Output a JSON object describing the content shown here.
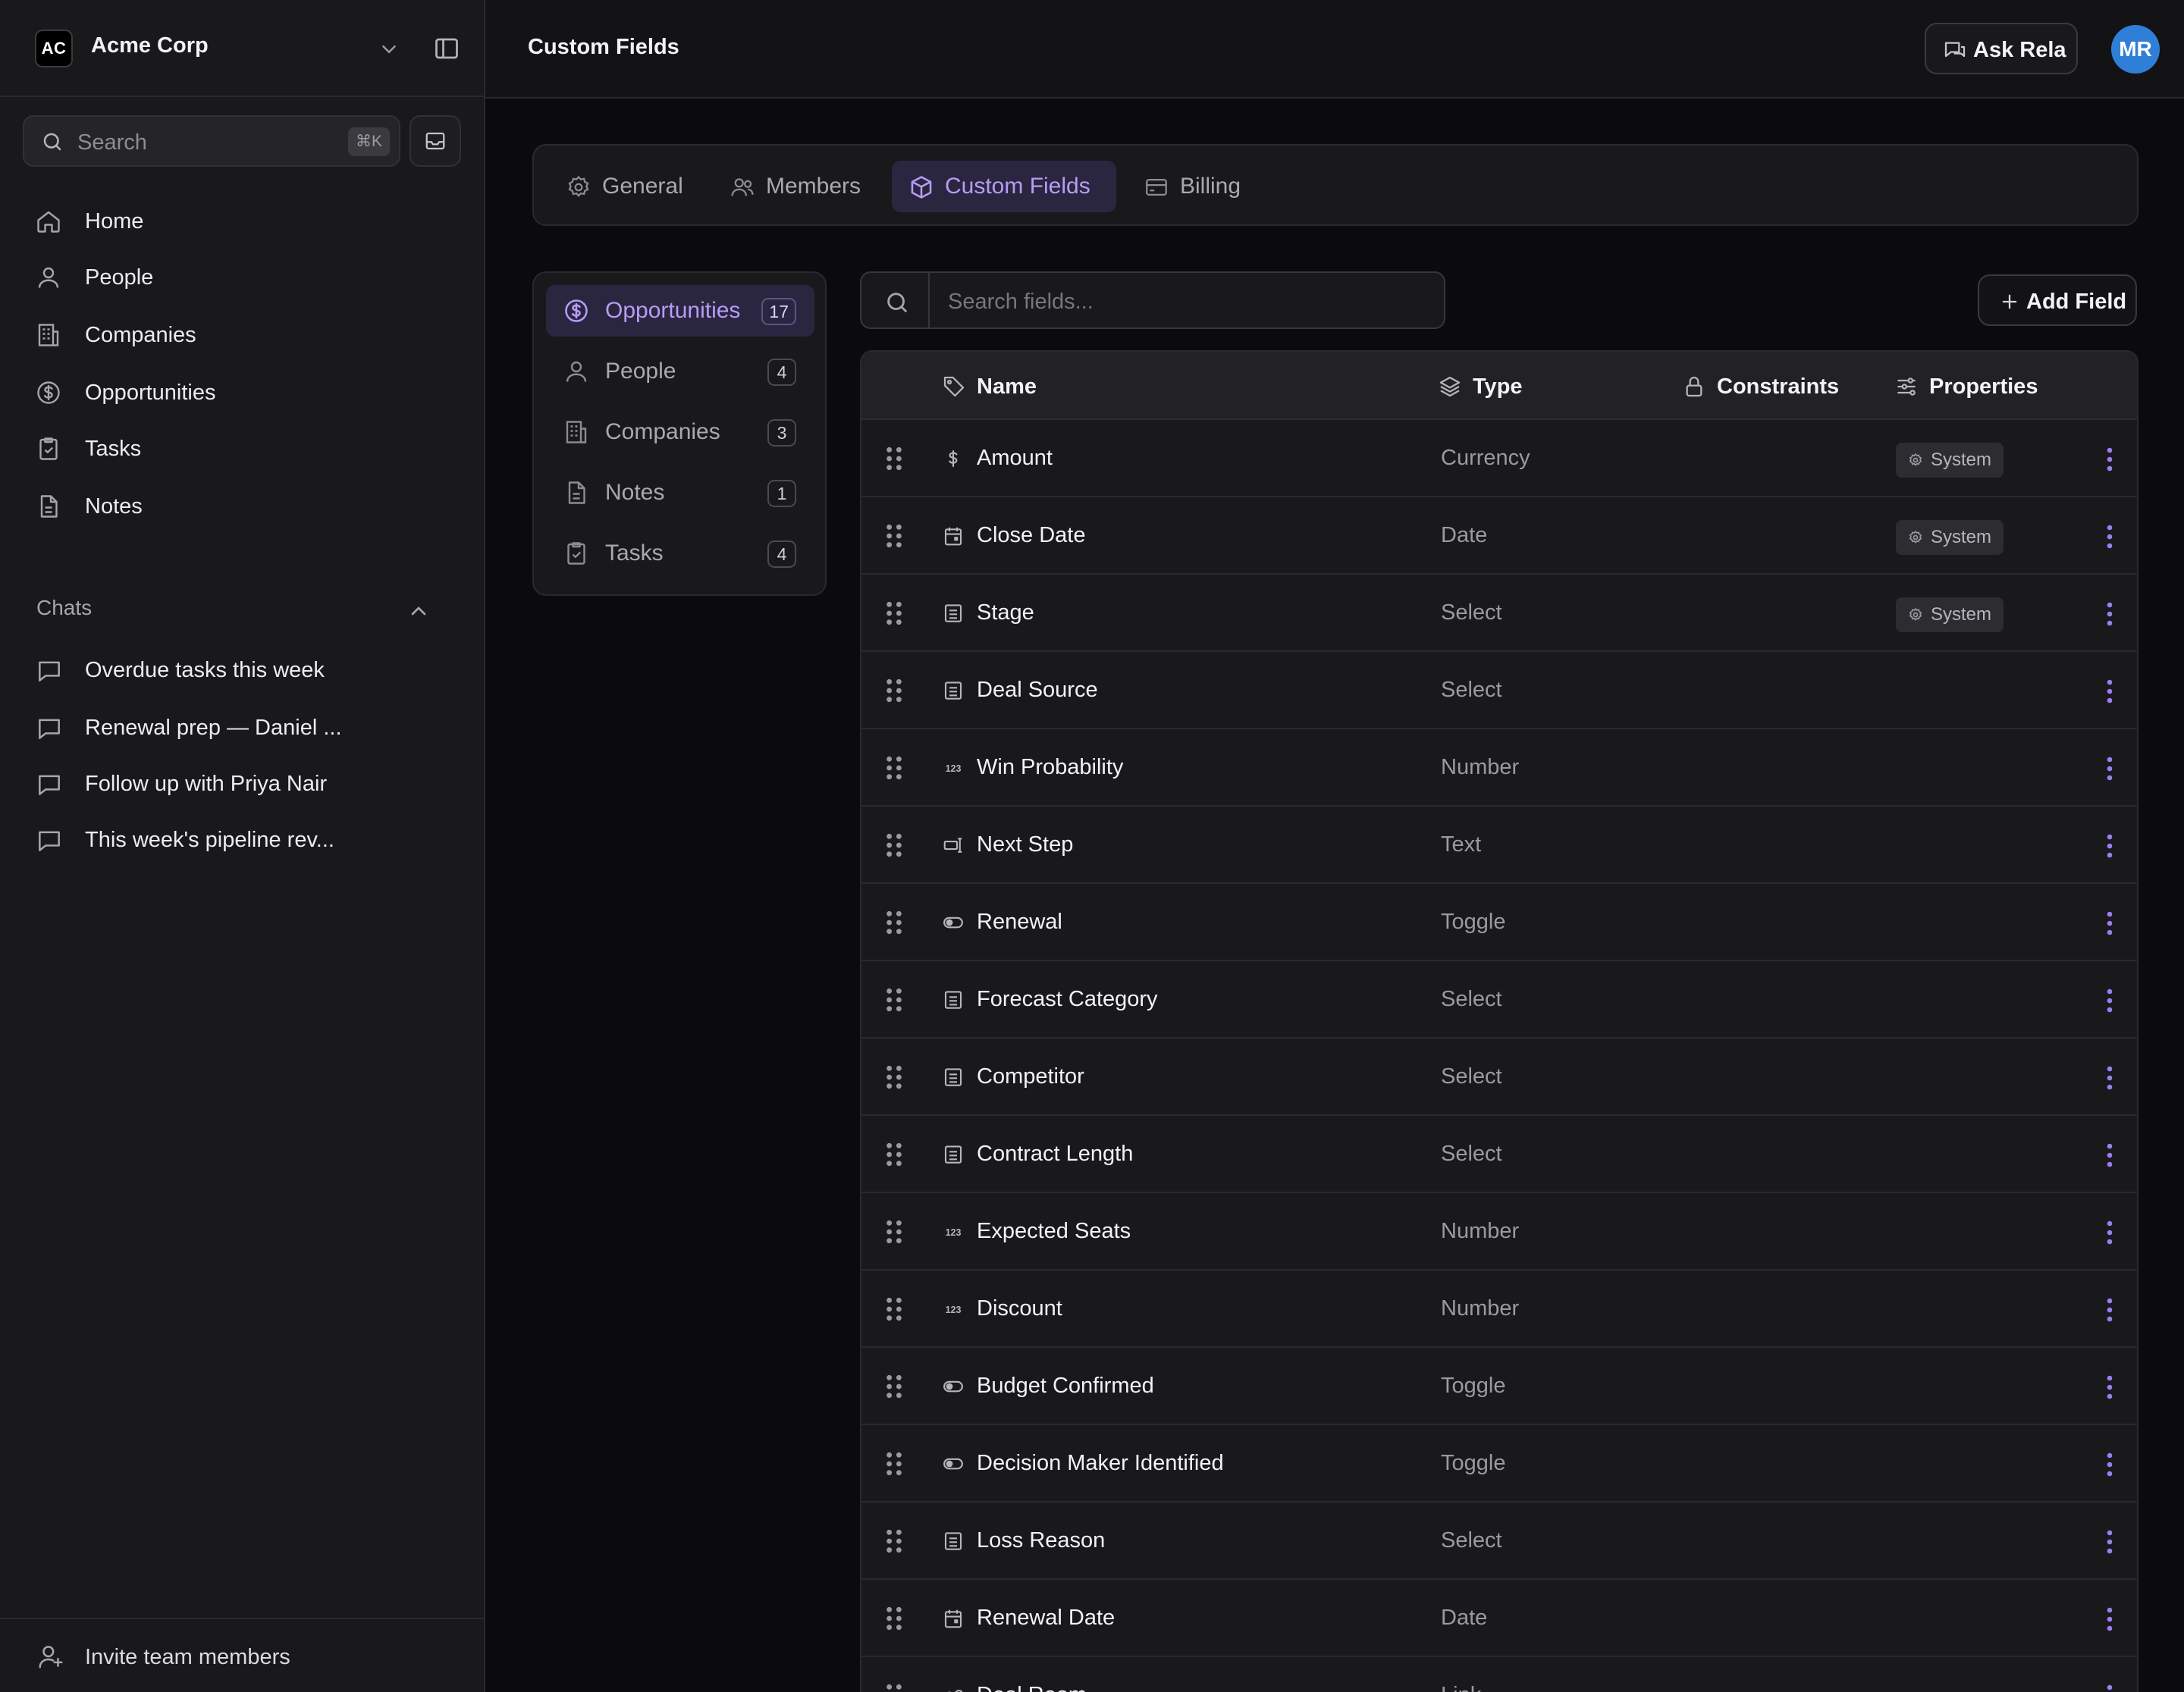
{
  "workspace": {
    "initials": "AC",
    "name": "Acme Corp"
  },
  "search": {
    "label": "Search",
    "shortcut": "⌘K"
  },
  "nav": [
    {
      "label": "Home",
      "icon": "home-icon"
    },
    {
      "label": "People",
      "icon": "person-icon"
    },
    {
      "label": "Companies",
      "icon": "building-icon"
    },
    {
      "label": "Opportunities",
      "icon": "dollar-circle-icon"
    },
    {
      "label": "Tasks",
      "icon": "clipboard-check-icon"
    },
    {
      "label": "Notes",
      "icon": "file-icon"
    }
  ],
  "chats": {
    "title": "Chats",
    "items": [
      {
        "label": "Overdue tasks this week"
      },
      {
        "label": "Renewal prep — Daniel ..."
      },
      {
        "label": "Follow up with Priya Nair"
      },
      {
        "label": "This week's pipeline rev..."
      }
    ]
  },
  "invite": {
    "label": "Invite team members"
  },
  "topbar": {
    "title": "Custom Fields",
    "ask_label": "Ask Rela",
    "avatar_initials": "MR"
  },
  "tabs": [
    {
      "label": "General",
      "icon": "gear-icon",
      "active": false
    },
    {
      "label": "Members",
      "icon": "users-icon",
      "active": false
    },
    {
      "label": "Custom Fields",
      "icon": "cube-icon",
      "active": true
    },
    {
      "label": "Billing",
      "icon": "credit-card-icon",
      "active": false
    }
  ],
  "objects": [
    {
      "label": "Opportunities",
      "count": "17",
      "icon": "dollar-circle-icon",
      "active": true
    },
    {
      "label": "People",
      "count": "4",
      "icon": "person-icon",
      "active": false
    },
    {
      "label": "Companies",
      "count": "3",
      "icon": "building-icon",
      "active": false
    },
    {
      "label": "Notes",
      "count": "1",
      "icon": "file-icon",
      "active": false
    },
    {
      "label": "Tasks",
      "count": "4",
      "icon": "clipboard-check-icon",
      "active": false
    }
  ],
  "field_search": {
    "placeholder": "Search fields..."
  },
  "add_field": {
    "label": "Add Field"
  },
  "table": {
    "headers": {
      "name": "Name",
      "type": "Type",
      "constraints": "Constraints",
      "properties": "Properties"
    },
    "rows": [
      {
        "name": "Amount",
        "type": "Currency",
        "icon": "dollar-icon",
        "badge": "System"
      },
      {
        "name": "Close Date",
        "type": "Date",
        "icon": "calendar-icon",
        "badge": "System"
      },
      {
        "name": "Stage",
        "type": "Select",
        "icon": "list-icon",
        "badge": "System"
      },
      {
        "name": "Deal Source",
        "type": "Select",
        "icon": "list-icon",
        "badge": ""
      },
      {
        "name": "Win Probability",
        "type": "Number",
        "icon": "number-icon",
        "badge": ""
      },
      {
        "name": "Next Step",
        "type": "Text",
        "icon": "text-cursor-icon",
        "badge": ""
      },
      {
        "name": "Renewal",
        "type": "Toggle",
        "icon": "toggle-icon",
        "badge": ""
      },
      {
        "name": "Forecast Category",
        "type": "Select",
        "icon": "list-icon",
        "badge": ""
      },
      {
        "name": "Competitor",
        "type": "Select",
        "icon": "list-icon",
        "badge": ""
      },
      {
        "name": "Contract Length",
        "type": "Select",
        "icon": "list-icon",
        "badge": ""
      },
      {
        "name": "Expected Seats",
        "type": "Number",
        "icon": "number-icon",
        "badge": ""
      },
      {
        "name": "Discount",
        "type": "Number",
        "icon": "number-icon",
        "badge": ""
      },
      {
        "name": "Budget Confirmed",
        "type": "Toggle",
        "icon": "toggle-icon",
        "badge": ""
      },
      {
        "name": "Decision Maker Identified",
        "type": "Toggle",
        "icon": "toggle-icon",
        "badge": ""
      },
      {
        "name": "Loss Reason",
        "type": "Select",
        "icon": "list-icon",
        "badge": ""
      },
      {
        "name": "Renewal Date",
        "type": "Date",
        "icon": "calendar-icon",
        "badge": ""
      },
      {
        "name": "Deal Room",
        "type": "Link",
        "icon": "link-icon",
        "badge": ""
      }
    ]
  },
  "colors": {
    "accent": "#b79cf5",
    "accent_bg": "#2a2640",
    "avatar": "#2f7fd8",
    "menu_dots": "#9b7ef0"
  }
}
